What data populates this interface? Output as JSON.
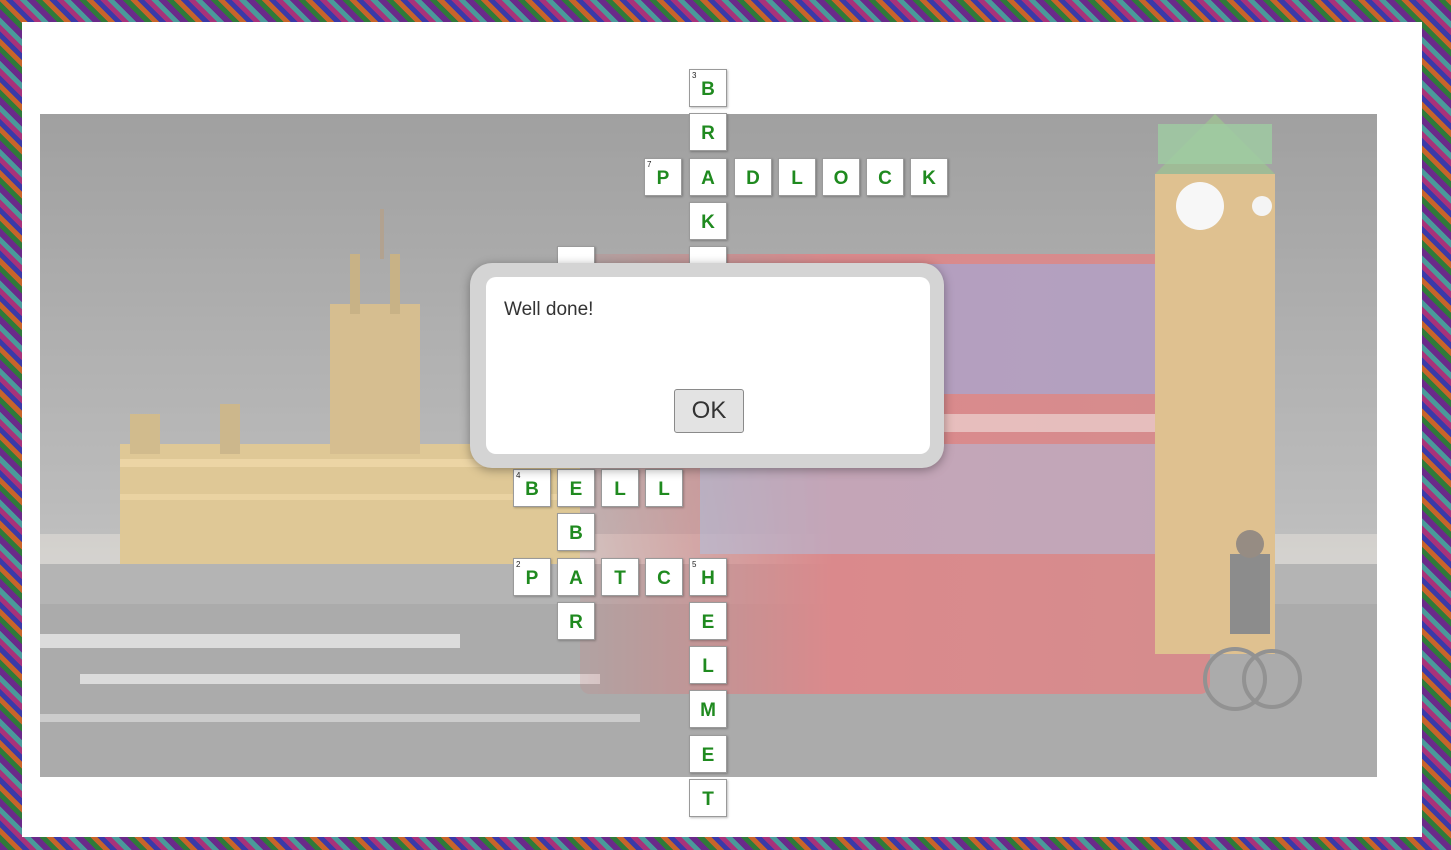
{
  "dialog": {
    "message": "Well done!",
    "ok_label": "OK"
  },
  "crossword": {
    "words": [
      {
        "number": "3",
        "answer": "BRAKE",
        "direction": "down"
      },
      {
        "number": "7",
        "answer": "PADLOCK",
        "direction": "across"
      },
      {
        "number": "4",
        "answer": "BELL",
        "direction": "across"
      },
      {
        "number": "2",
        "answer": "PATCH",
        "direction": "across"
      },
      {
        "number": "5",
        "answer": "HELMET",
        "direction": "down"
      },
      {
        "number": "",
        "answer": "EBAR",
        "direction": "down"
      }
    ],
    "cells": [
      {
        "letter": "B",
        "number": "3"
      },
      {
        "letter": "R",
        "number": ""
      },
      {
        "letter": "P",
        "number": "7"
      },
      {
        "letter": "A",
        "number": ""
      },
      {
        "letter": "D",
        "number": ""
      },
      {
        "letter": "L",
        "number": ""
      },
      {
        "letter": "O",
        "number": ""
      },
      {
        "letter": "C",
        "number": ""
      },
      {
        "letter": "K",
        "number": ""
      },
      {
        "letter": "K",
        "number": ""
      },
      {
        "letter": "B",
        "number": "4"
      },
      {
        "letter": "E",
        "number": ""
      },
      {
        "letter": "L",
        "number": ""
      },
      {
        "letter": "L",
        "number": ""
      },
      {
        "letter": "B",
        "number": ""
      },
      {
        "letter": "P",
        "number": "2"
      },
      {
        "letter": "A",
        "number": ""
      },
      {
        "letter": "T",
        "number": ""
      },
      {
        "letter": "C",
        "number": ""
      },
      {
        "letter": "H",
        "number": "5"
      },
      {
        "letter": "R",
        "number": ""
      },
      {
        "letter": "E",
        "number": ""
      },
      {
        "letter": "L",
        "number": ""
      },
      {
        "letter": "M",
        "number": ""
      },
      {
        "letter": "E",
        "number": ""
      },
      {
        "letter": "T",
        "number": ""
      }
    ]
  },
  "colors": {
    "letter": "#1f8a1f",
    "dialog_border": "#d4d4d4",
    "bus_red": "#b8383a"
  }
}
